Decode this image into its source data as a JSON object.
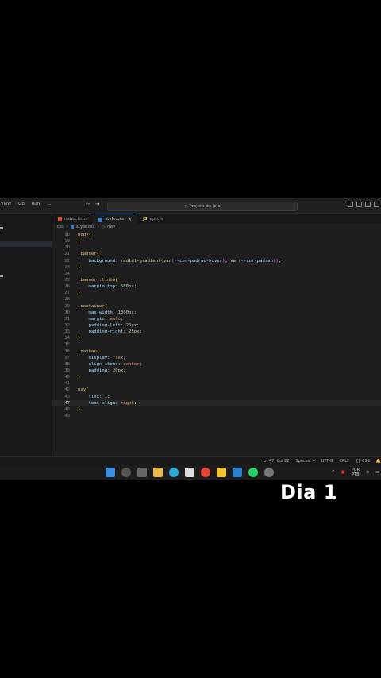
{
  "titlebar": {
    "menu": [
      "View",
      "Go",
      "Run",
      "..."
    ],
    "search": "Projeto de loja"
  },
  "tabs": [
    {
      "label": "index.html",
      "icon": "html-file-icon"
    },
    {
      "label": "style.css",
      "icon": "css-file-icon"
    },
    {
      "label": "app.js",
      "icon": "js-file-icon"
    }
  ],
  "breadcrumb": {
    "folder": "css",
    "file": "style.css",
    "symbol": "nav"
  },
  "code": {
    "lines": [
      {
        "n": "18",
        "t": "body{"
      },
      {
        "n": "19",
        "t": "}"
      },
      {
        "n": "20",
        "t": ""
      },
      {
        "n": "21",
        "t": ".banner{"
      },
      {
        "n": "22",
        "t": "    background: radial-gradient(var(--cor-padrao-hover), var(--cor-padrao));"
      },
      {
        "n": "23",
        "t": "}"
      },
      {
        "n": "24",
        "t": ""
      },
      {
        "n": "25",
        "t": ".banner .linha{"
      },
      {
        "n": "26",
        "t": "    margin-top: 500px;"
      },
      {
        "n": "27",
        "t": "}"
      },
      {
        "n": "28",
        "t": ""
      },
      {
        "n": "29",
        "t": ".container{"
      },
      {
        "n": "30",
        "t": "    max-width: 1300px;"
      },
      {
        "n": "31",
        "t": "    margin: auto;"
      },
      {
        "n": "32",
        "t": "    padding-left: 25px;"
      },
      {
        "n": "33",
        "t": "    padding-right: 25px;"
      },
      {
        "n": "34",
        "t": "}"
      },
      {
        "n": "35",
        "t": ""
      },
      {
        "n": "36",
        "t": ".navbar{"
      },
      {
        "n": "37",
        "t": "    display: flex;"
      },
      {
        "n": "38",
        "t": "    align-items: center;"
      },
      {
        "n": "39",
        "t": "    padding: 20px;"
      },
      {
        "n": "40",
        "t": "}"
      },
      {
        "n": "41",
        "t": ""
      },
      {
        "n": "42",
        "t": "nav{"
      },
      {
        "n": "43",
        "t": "    flex: 1;"
      },
      {
        "n": "47",
        "t": "    text-align: right;"
      },
      {
        "n": "48",
        "t": "}"
      },
      {
        "n": "49",
        "t": ""
      }
    ]
  },
  "statusbar": {
    "position": "Ln 47, Col 22",
    "spaces": "Spaces: 4",
    "encoding": "UTF-8",
    "eol": "CRLF",
    "language": "CSS"
  },
  "taskbar": {
    "lang1": "POR",
    "lang2": "PTB"
  },
  "caption": "Dia 1"
}
